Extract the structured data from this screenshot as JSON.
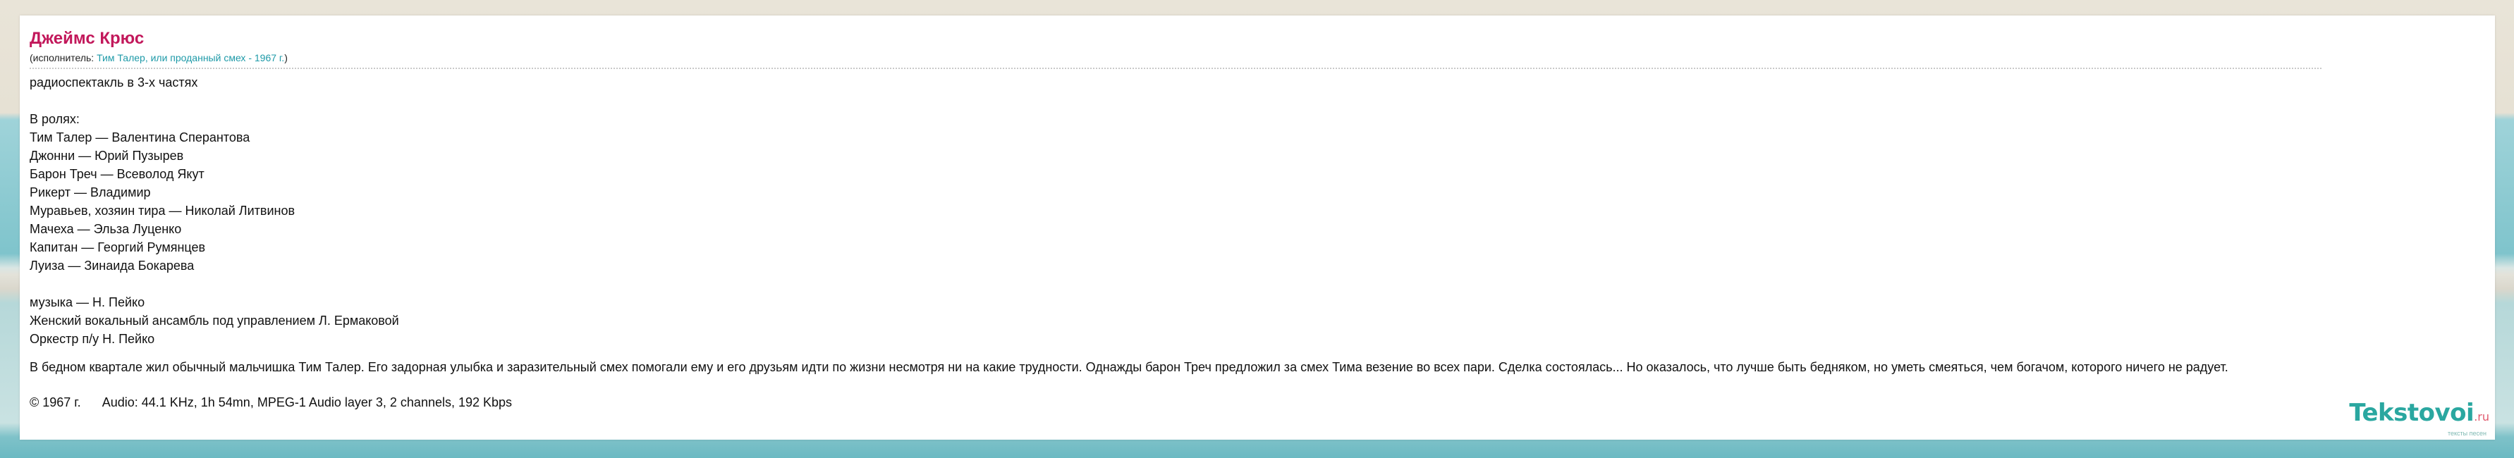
{
  "header": {
    "title": "Джеймс Крюс",
    "performer_prefix": "(исполнитель: ",
    "performer_link": "Тим Талер, или проданный смех - 1967 г.",
    "performer_suffix": ")"
  },
  "content": {
    "intro": "радиоспектакль в 3-х частях",
    "roles_heading": "В ролях:",
    "roles": [
      "Тим Талер — Валентина Сперантова",
      "Джонни — Юрий Пузырев",
      "Барон Треч — Всеволод Якут",
      "Рикерт — Владимир",
      "Муравьев, хозяин тира — Николай Литвинов",
      "Мачеха — Эльза Луценко",
      "Капитан — Георгий Румянцев",
      "Луиза — Зинаида Бокарева"
    ],
    "credits": [
      "музыка — Н. Пейко",
      "Женский вокальный ансамбль под управлением Л. Ермаковой",
      "Оркестр п/у Н. Пейко"
    ],
    "description": "В бедном квартале жил обычный мальчишка Тим Талер. Его задорная улыбка и заразительный смех помогали ему и его друзьям идти по жизни несмотря ни на какие трудности. Однажды барон Треч предложил за смех Тима везение во всех пари. Сделка состоялась... Но оказалось, что лучше быть бедняком, но уметь смеяться, чем богачом, которого ничего не радует.",
    "copyright": "© 1967 г.",
    "audio_info": "Audio: 44.1 KHz, 1h 54mn, MPEG-1 Audio layer 3, 2 channels, 192 Kbps"
  },
  "logo": {
    "brand": "Tekstovoi",
    "tld": ".ru",
    "tagline": "тексты песен"
  }
}
